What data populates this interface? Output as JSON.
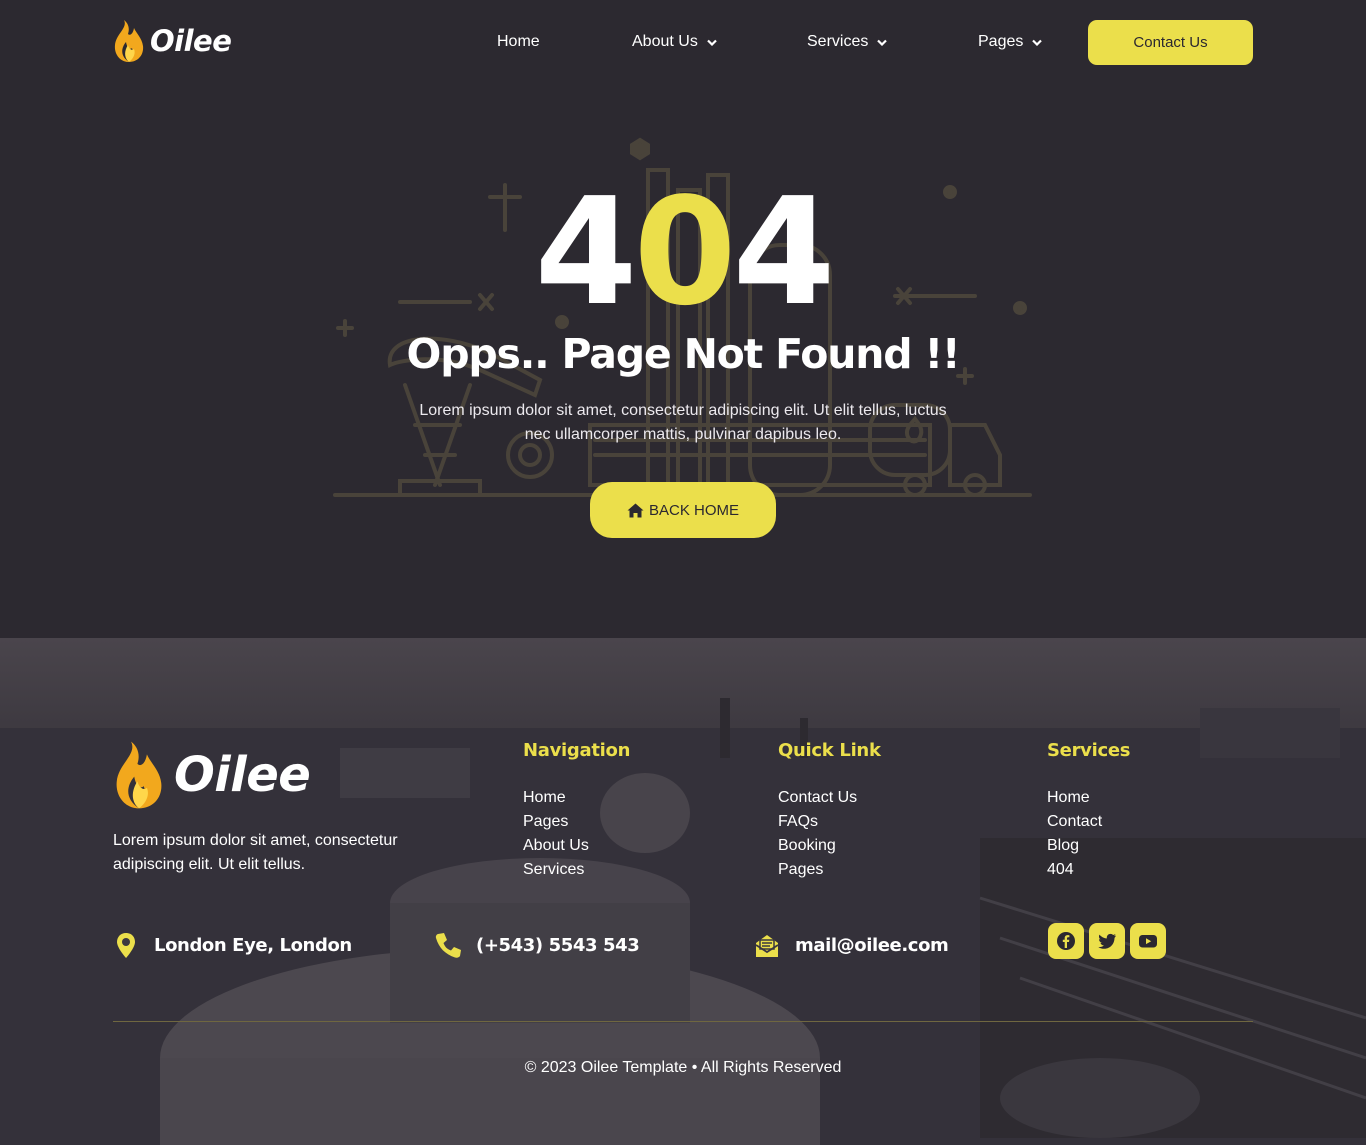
{
  "brand": {
    "name": "Oilee",
    "accent": "#ebdf4b",
    "background": "#2c2930"
  },
  "header": {
    "nav": [
      {
        "label": "Home",
        "dropdown": false
      },
      {
        "label": "About Us",
        "dropdown": true
      },
      {
        "label": "Services",
        "dropdown": true
      },
      {
        "label": "Pages",
        "dropdown": true
      }
    ],
    "cta_label": "Contact Us"
  },
  "hero": {
    "code_digits": [
      "4",
      "0",
      "4"
    ],
    "title": "Opps.. Page Not Found !!",
    "text": "Lorem ipsum dolor sit amet, consectetur adipiscing elit. Ut elit tellus, luctus nec ullamcorper mattis, pulvinar dapibus leo.",
    "button_label": "BACK HOME",
    "button_icon": "home-icon"
  },
  "footer": {
    "about": "Lorem ipsum dolor sit amet, consectetur adipiscing elit. Ut elit tellus.",
    "columns": [
      {
        "title": "Navigation",
        "links": [
          "Home",
          "Pages",
          "About Us",
          "Services"
        ]
      },
      {
        "title": "Quick Link",
        "links": [
          "Contact Us",
          "FAQs",
          "Booking",
          "Pages"
        ]
      },
      {
        "title": "Services",
        "links": [
          "Home",
          "Contact",
          "Blog",
          "404"
        ]
      }
    ],
    "contacts": {
      "address": {
        "icon": "map-pin-icon",
        "text": "London Eye, London"
      },
      "phone": {
        "icon": "phone-icon",
        "text": "(+543) 5543 543"
      },
      "email": {
        "icon": "envelope-icon",
        "text": "mail@oilee.com"
      }
    },
    "social": [
      "facebook-icon",
      "twitter-icon",
      "youtube-icon"
    ],
    "copyright": "© 2023 Oilee Template • All Rights Reserved"
  }
}
